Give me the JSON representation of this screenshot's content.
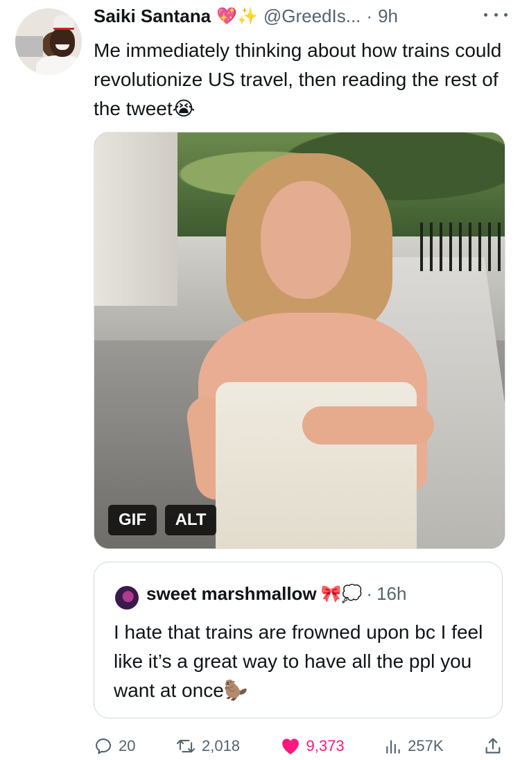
{
  "tweet": {
    "author_name": "Saiki Santana",
    "name_emojis": "💖✨",
    "handle": "@GreedIs...",
    "separator": "·",
    "time": "9h",
    "text": "Me immediately thinking about how trains could revolutionize US travel, then reading the rest of the tweet😭"
  },
  "media": {
    "gif_badge": "GIF",
    "alt_badge": "ALT"
  },
  "quote": {
    "author_name": "sweet marshmallow",
    "name_emojis": "🎀💭",
    "separator": "·",
    "time": "16h",
    "text": "I hate that trains are frowned upon bc I feel like it’s a great way to have all the ppl you want at once🦫"
  },
  "actions": {
    "replies": "20",
    "retweets": "2,018",
    "likes": "9,373",
    "views": "257K"
  },
  "colors": {
    "text": "#0f1419",
    "secondary": "#536471",
    "like": "#f91880",
    "border": "#cfd9de"
  },
  "icons": [
    "more-icon",
    "reply-icon",
    "retweet-icon",
    "heart-icon",
    "views-icon",
    "share-icon"
  ]
}
